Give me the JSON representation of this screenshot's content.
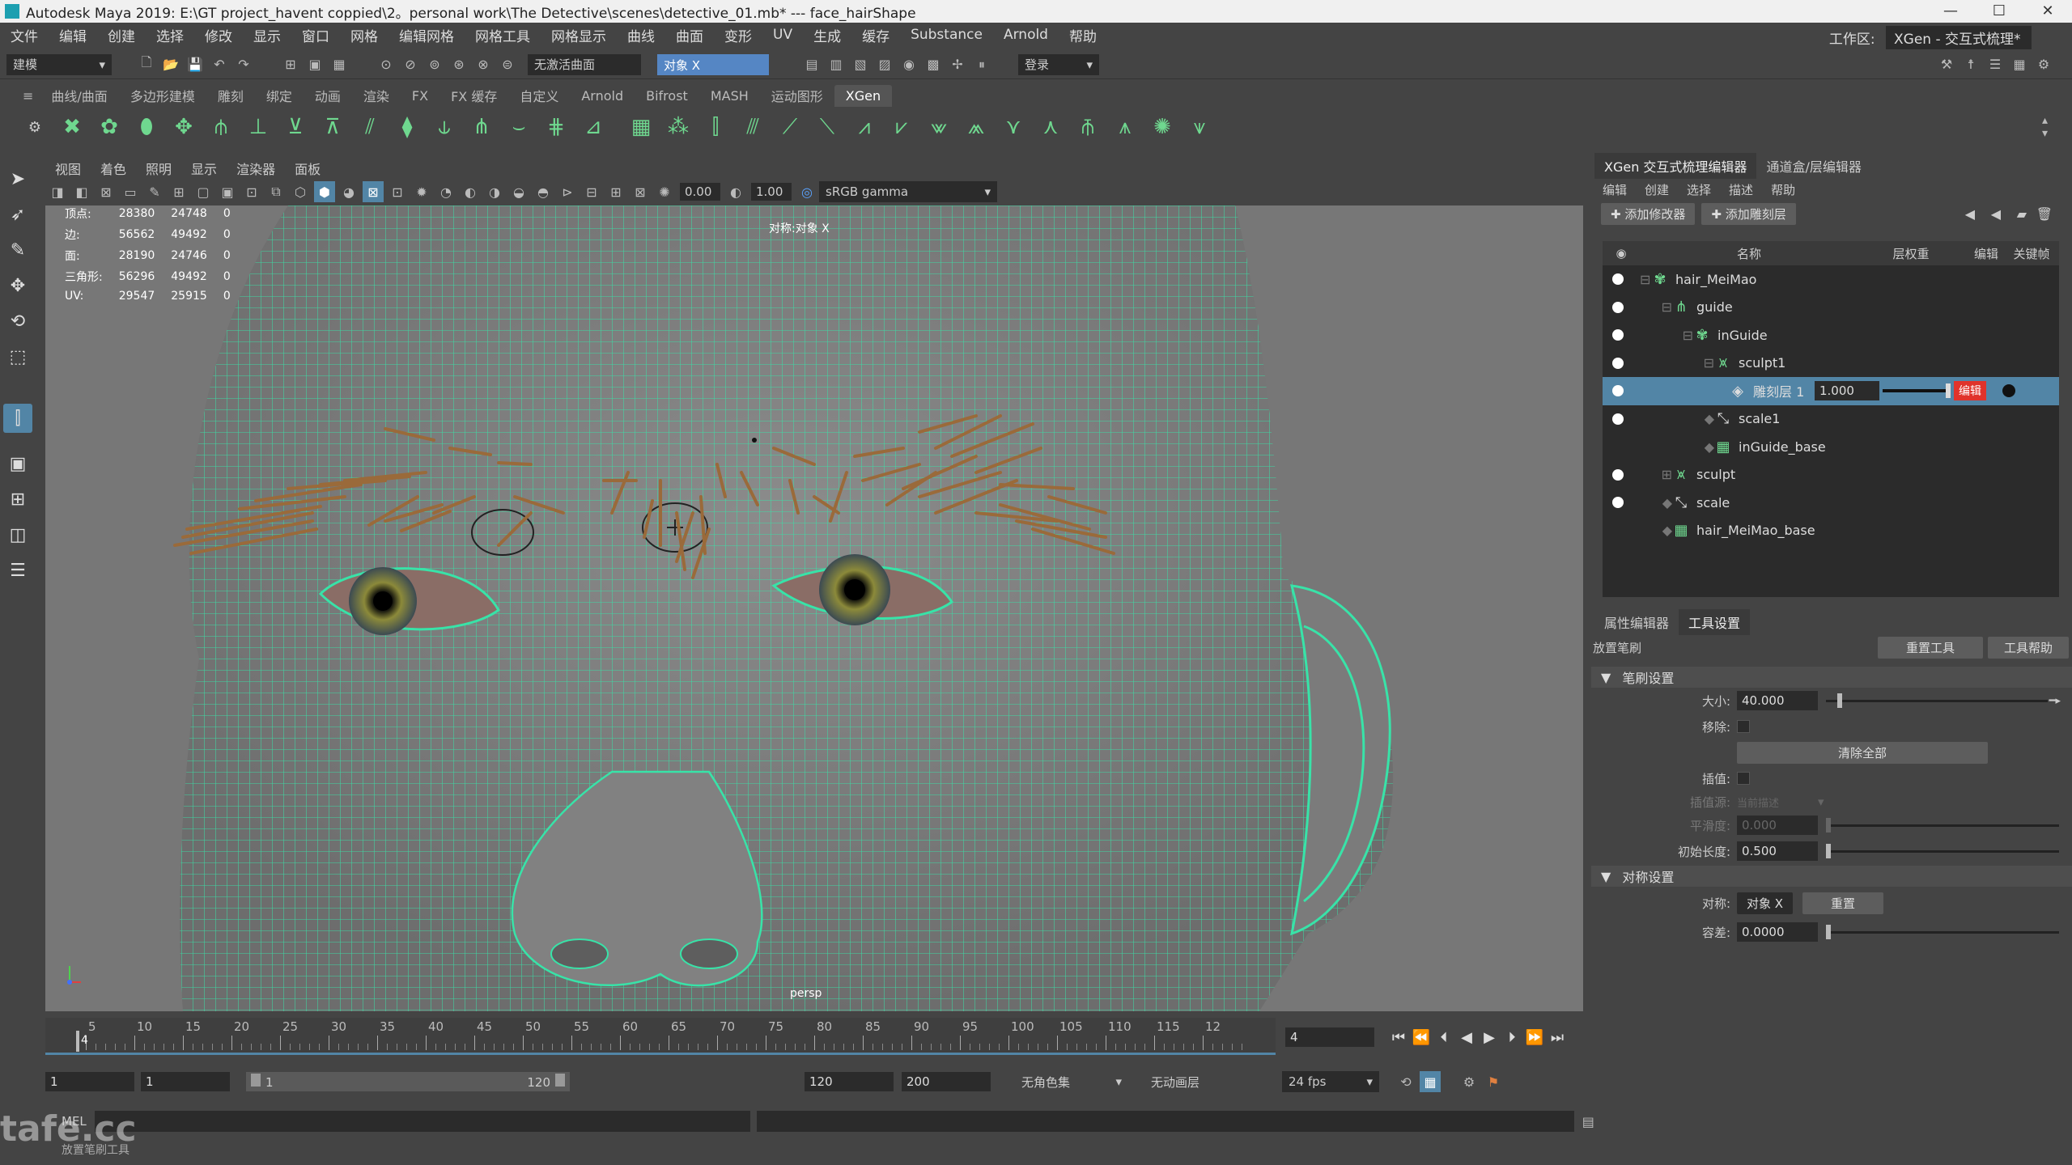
{
  "window": {
    "title": "Autodesk Maya 2019: E:\\GT project_havent coppied\\2。personal work\\The Detective\\scenes\\detective_01.mb*  ---  face_hairShape",
    "minimize": "—",
    "maximize": "☐",
    "close": "✕"
  },
  "menubar": {
    "items": [
      "文件",
      "编辑",
      "创建",
      "选择",
      "修改",
      "显示",
      "窗口",
      "网格",
      "编辑网格",
      "网格工具",
      "网格显示",
      "曲线",
      "曲面",
      "变形",
      "UV",
      "生成",
      "缓存",
      "Substance",
      "Arnold",
      "帮助"
    ],
    "workspace_label": "工作区:",
    "workspace_value": "XGen - 交互式梳理*"
  },
  "statusline": {
    "mode": "建模",
    "live_surface": "无激活曲面",
    "symmetry": "对象 X",
    "login": "登录"
  },
  "shelf": {
    "tabs": [
      "曲线/曲面",
      "多边形建模",
      "雕刻",
      "绑定",
      "动画",
      "渲染",
      "FX",
      "FX 缓存",
      "自定义",
      "Arnold",
      "Bifrost",
      "MASH",
      "运动图形",
      "XGen"
    ],
    "active_tab": "XGen"
  },
  "viewport": {
    "menu": [
      "视图",
      "着色",
      "照明",
      "显示",
      "渲染器",
      "面板"
    ],
    "exposure": "0.00",
    "gamma": "1.00",
    "color_space": "sRGB gamma",
    "hud": [
      {
        "label": "顶点:",
        "a": "28380",
        "b": "24748",
        "c": "0"
      },
      {
        "label": "边:",
        "a": "56562",
        "b": "49492",
        "c": "0"
      },
      {
        "label": "面:",
        "a": "28190",
        "b": "24746",
        "c": "0"
      },
      {
        "label": "三角形:",
        "a": "56296",
        "b": "49492",
        "c": "0"
      },
      {
        "label": "UV:",
        "a": "29547",
        "b": "25915",
        "c": "0"
      }
    ],
    "symmetry_label": "对称:对象 X",
    "camera": "persp"
  },
  "xgen_panel": {
    "tabs": [
      "XGen 交互式梳理编辑器",
      "通道盒/层编辑器"
    ],
    "menu": [
      "编辑",
      "创建",
      "选择",
      "描述",
      "帮助"
    ],
    "add_modifier": "添加修改器",
    "add_sculpt_layer": "添加雕刻层",
    "columns": {
      "name": "名称",
      "weight": "层权重",
      "edit": "编辑",
      "keyframe": "关键帧"
    },
    "tree": [
      {
        "name": "hair_MeiMao",
        "depth": 0,
        "icon": "xgen-description-icon"
      },
      {
        "name": "guide",
        "depth": 1,
        "icon": "guide-icon"
      },
      {
        "name": "inGuide",
        "depth": 2,
        "icon": "xgen-description-icon"
      },
      {
        "name": "sculpt1",
        "depth": 3,
        "icon": "sculpt-icon"
      },
      {
        "name": "雕刻层 1",
        "depth": 4,
        "icon": "layer-icon",
        "selected": true,
        "weight": "1.000",
        "edit": "编辑"
      },
      {
        "name": "scale1",
        "depth": 3,
        "icon": "scale-icon"
      },
      {
        "name": "inGuide_base",
        "depth": 3,
        "icon": "base-icon"
      },
      {
        "name": "sculpt",
        "depth": 1,
        "icon": "sculpt-icon"
      },
      {
        "name": "scale",
        "depth": 1,
        "icon": "scale-icon"
      },
      {
        "name": "hair_MeiMao_base",
        "depth": 1,
        "icon": "base-icon"
      }
    ]
  },
  "tool_settings": {
    "tabs": [
      "属性编辑器",
      "工具设置"
    ],
    "tool_name": "放置笔刷",
    "reset_tool": "重置工具",
    "tool_help": "工具帮助",
    "brush_section": "笔刷设置",
    "size_label": "大小:",
    "size_value": "40.000",
    "size_level": 0.05,
    "remove_label": "移除:",
    "clear_all": "清除全部",
    "interp_label": "插值:",
    "interp_source_label": "插值源:",
    "interp_source_value": "当前描述",
    "smooth_label": "平滑度:",
    "smooth_value": "0.000",
    "init_length_label": "初始长度:",
    "init_length_value": "0.500",
    "symmetry_section": "对称设置",
    "sym_label": "对称:",
    "sym_value": "对象 X",
    "sym_reset": "重置",
    "tolerance_label": "容差:",
    "tolerance_value": "0.0000"
  },
  "timeline": {
    "ticks": [
      "5",
      "10",
      "15",
      "20",
      "25",
      "30",
      "35",
      "40",
      "45",
      "50",
      "55",
      "60",
      "65",
      "70",
      "75",
      "80",
      "85",
      "90",
      "95",
      "100",
      "105",
      "110",
      "115",
      "12"
    ],
    "current_marker": "4",
    "current_frame": "4",
    "range_start": "1",
    "playback_start": "1",
    "range_inner_start": "1",
    "range_inner_end": "120",
    "playback_end": "120",
    "range_end": "200",
    "character_set": "无角色集",
    "anim_layer": "无动画层",
    "fps": "24 fps"
  },
  "commandline": {
    "label": "MEL"
  },
  "helpline": {
    "text": "放置笔刷工具"
  },
  "watermark": "tafe.cc",
  "colors": {
    "wire": "#38e3a8",
    "selection": "#5285a6",
    "edit_red": "#e0332b",
    "xgen_green": "#6fd88f"
  }
}
